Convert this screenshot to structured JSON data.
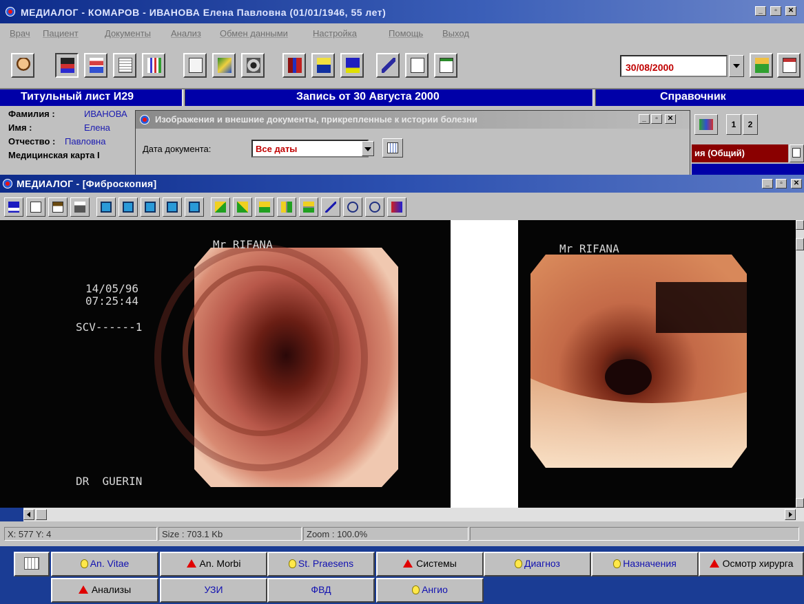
{
  "app": {
    "title": "МЕДИАЛОГ - КОМАРОВ - ИВАНОВА Елена Павловна (01/01/1946, 55 лет)"
  },
  "menu": [
    "Врач",
    "Пациент",
    "Документы",
    "Анализ",
    "Обмен данными",
    "Настройка",
    "Помощь",
    "Выход"
  ],
  "toolbar": {
    "date_value": "30/08/2000"
  },
  "header_band": {
    "left": "Титульный лист И29",
    "center": "Запись от 30 Августа 2000",
    "right": "Справочник"
  },
  "patient": {
    "surname_label": "Фамилия :",
    "surname_value": "ИВАНОВА",
    "name_label": "Имя :",
    "name_value": "Елена",
    "patronymic_label": "Отчество :",
    "patronymic_value": "Павловна",
    "card_label": "Медицинская карта I"
  },
  "doc_dialog": {
    "title": "Изображения и внешние документы, прикрепленные к истории болезни",
    "date_label": "Дата документа:",
    "date_value": "Все даты"
  },
  "right_panel": {
    "page1": "1",
    "page2": "2",
    "section_label": "ия (Общий)"
  },
  "viewer_window": {
    "title": "МЕДИАЛОГ - [Фиброскопия]"
  },
  "image_overlay": {
    "left_name": "Mr RIFANA",
    "date": "14/05/96",
    "time": "07:25:44",
    "scv": "SCV------1",
    "doctor": "DR  GUERIN",
    "right_name": "Mr RIFANA"
  },
  "status": {
    "coords": "X: 577 Y: 4",
    "size": "Size : 703.1 Kb",
    "zoom": "Zoom : 100.0%"
  },
  "tabs_row1": [
    {
      "label": "An. Vitae",
      "marker": "bulb"
    },
    {
      "label": "An. Morbi",
      "marker": "triangle"
    },
    {
      "label": "St. Praesens",
      "marker": "bulb"
    },
    {
      "label": "Системы",
      "marker": "triangle"
    },
    {
      "label": "Диагноз",
      "marker": "bulb"
    },
    {
      "label": "Назначения",
      "marker": "bulb"
    },
    {
      "label": "Осмотр хирурга",
      "marker": "triangle"
    }
  ],
  "tabs_row2": [
    {
      "label": "Анализы",
      "marker": "triangle"
    },
    {
      "label": "УЗИ",
      "marker": "none"
    },
    {
      "label": "ФВД",
      "marker": "none"
    },
    {
      "label": "Ангио",
      "marker": "bulb"
    }
  ],
  "colors": {
    "desktop": "#1a3c94",
    "band": "#0000a8",
    "date_text": "#c00000",
    "link_text": "#1010b0",
    "alert": "#e00000"
  }
}
